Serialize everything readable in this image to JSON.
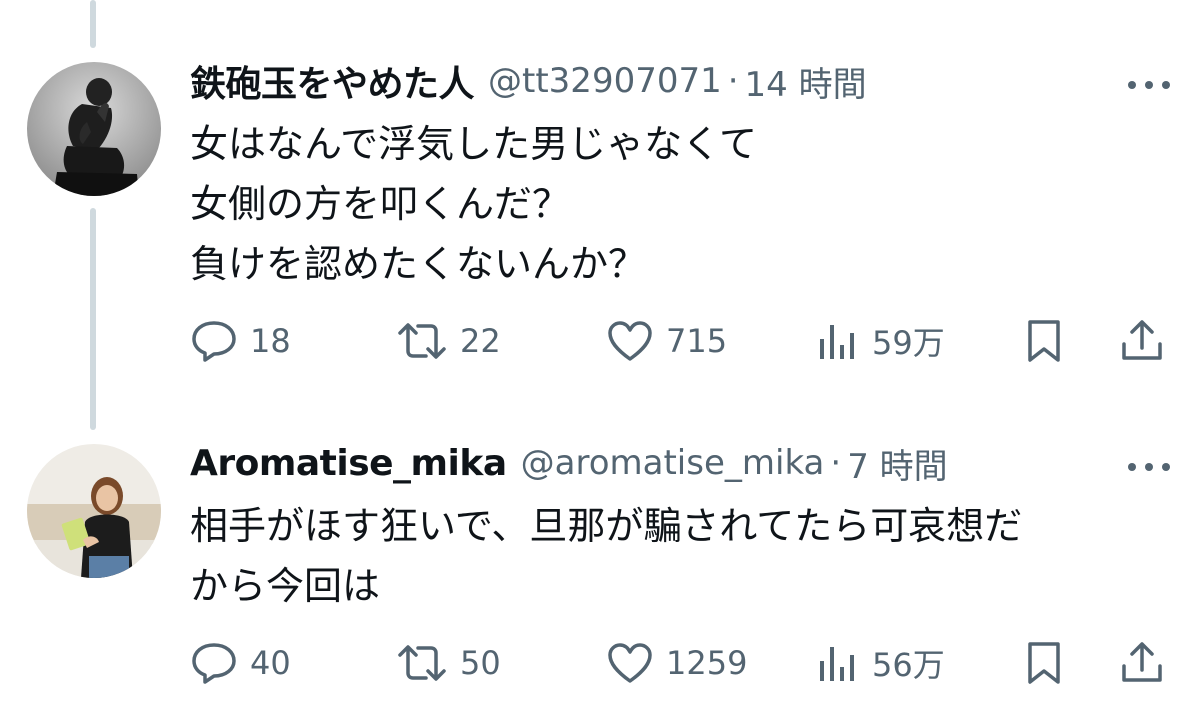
{
  "tweets": [
    {
      "display_name": "鉄砲玉をやめた人",
      "handle": "@tt32907071",
      "separator": "·",
      "time": "14 時間",
      "text": "女はなんで浮気した男じゃなくて\n女側の方を叩くんだ？\n負けを認めたくないんか？",
      "avatar_icon": "thinker-statue-avatar",
      "replies": "18",
      "retweets": "22",
      "likes": "715",
      "views": "59万"
    },
    {
      "display_name": "Aromatise_mika",
      "handle": "@aromatise_mika",
      "separator": "·",
      "time": "7 時間",
      "text": "相手がほす狂いで、旦那が騙されてたら可哀想だ\nから今回は",
      "avatar_icon": "woman-holding-book-avatar",
      "replies": "40",
      "retweets": "50",
      "likes": "1259",
      "views": "56万"
    }
  ],
  "icons": {
    "reply": "reply-icon",
    "retweet": "retweet-icon",
    "like": "heart-icon",
    "views": "views-chart-icon",
    "bookmark": "bookmark-icon",
    "share": "share-icon",
    "more": "more-icon"
  },
  "colors": {
    "text": "#0f1419",
    "secondary": "#536471",
    "thread_line": "#cfd9de"
  }
}
